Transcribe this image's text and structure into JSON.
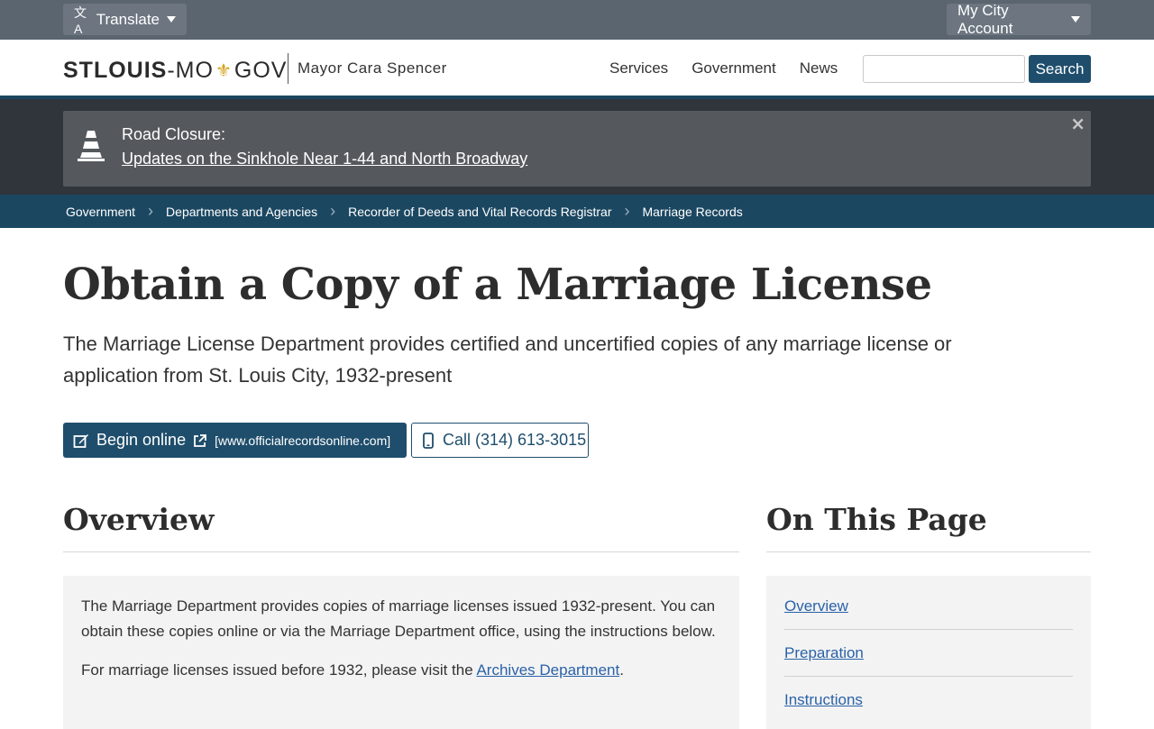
{
  "util": {
    "translate_label": "Translate",
    "account_label": "My City Account"
  },
  "header": {
    "logo_part1": "STLOUIS",
    "logo_part2": "-MO",
    "logo_part3": "GOV",
    "mayor": "Mayor Cara Spencer",
    "nav": [
      "Services",
      "Government",
      "News"
    ],
    "search_placeholder": "",
    "search_button": "Search"
  },
  "alert": {
    "title": "Road Closure:",
    "link": "Updates on the Sinkhole Near 1-44 and North Broadway",
    "close": "×"
  },
  "breadcrumb": [
    "Government",
    "Departments and Agencies",
    "Recorder of Deeds and Vital Records Registrar",
    "Marriage Records"
  ],
  "page": {
    "title": "Obtain a Copy of a Marriage License",
    "lede": "The Marriage License Department provides certified and uncertified copies of any marriage license or application from St. Louis City, 1932-present",
    "begin_online": "Begin online",
    "begin_url": "[www.officialrecordsonline.com]",
    "call": "Call (314) 613-3015"
  },
  "overview": {
    "heading": "Overview",
    "p1": "The Marriage Department provides copies of marriage licenses issued 1932-present. You can obtain these copies online or via the Marriage Department office, using the instructions below.",
    "p2_before": "For marriage licenses issued before 1932, please visit the ",
    "p2_link": "Archives Department",
    "p2_after": "."
  },
  "toc": {
    "heading": "On This Page",
    "items": [
      "Overview",
      "Preparation",
      "Instructions"
    ]
  },
  "colors": {
    "brand": "#1f4e6c",
    "utilbar": "#5b6570",
    "alert_band": "#2f353b",
    "link": "#2a62a8",
    "fleur": "#d3a21c"
  }
}
